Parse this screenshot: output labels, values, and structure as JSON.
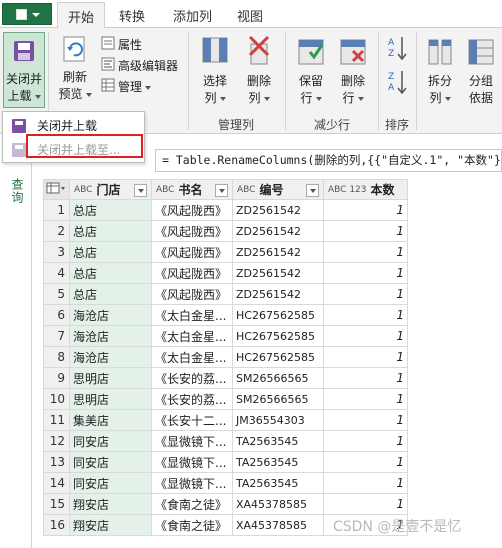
{
  "tabs": {
    "file_label": "",
    "items": [
      {
        "label": "开始",
        "active": true
      },
      {
        "label": "转换"
      },
      {
        "label": "添加列"
      },
      {
        "label": "视图"
      }
    ]
  },
  "ribbon": {
    "close_load": {
      "line1": "关闭并",
      "line2": "上载"
    },
    "refresh": {
      "line1": "刷新",
      "line2": "预览"
    },
    "properties_label": "属性",
    "advanced_editor_label": "高级编辑器",
    "manage_label": "管理",
    "choose_columns": {
      "line1": "选择",
      "line2": "列"
    },
    "remove_columns": {
      "line1": "删除",
      "line2": "列"
    },
    "group_manage_columns": "管理列",
    "keep_rows": {
      "line1": "保留",
      "line2": "行"
    },
    "remove_rows": {
      "line1": "删除",
      "line2": "行"
    },
    "group_reduce_rows": "减少行",
    "group_sort": "排序",
    "split_column": {
      "line1": "拆分",
      "line2": "列"
    },
    "group_by": {
      "line1": "分组",
      "line2": "依据"
    }
  },
  "menu": {
    "item1": "关闭并上载",
    "item2": "关闭并上载至..."
  },
  "queries_pane_label": "查询",
  "formula": "= Table.RenameColumns(删除的列,{{\"自定义.1\", \"本数\"}})",
  "table": {
    "columns": [
      {
        "type": "ABC",
        "name": "门店"
      },
      {
        "type": "ABC",
        "name": "书名"
      },
      {
        "type": "ABC",
        "name": "编号"
      },
      {
        "type": "ABC 123",
        "name": "本数"
      }
    ],
    "rows": [
      {
        "n": "1",
        "store": "总店",
        "book": "《风起陇西》",
        "code": "ZD2561542",
        "count": "1"
      },
      {
        "n": "2",
        "store": "总店",
        "book": "《风起陇西》",
        "code": "ZD2561542",
        "count": "1"
      },
      {
        "n": "3",
        "store": "总店",
        "book": "《风起陇西》",
        "code": "ZD2561542",
        "count": "1"
      },
      {
        "n": "4",
        "store": "总店",
        "book": "《风起陇西》",
        "code": "ZD2561542",
        "count": "1"
      },
      {
        "n": "5",
        "store": "总店",
        "book": "《风起陇西》",
        "code": "ZD2561542",
        "count": "1"
      },
      {
        "n": "6",
        "store": "海沧店",
        "book": "《太白金星...",
        "code": "HC267562585",
        "count": "1"
      },
      {
        "n": "7",
        "store": "海沧店",
        "book": "《太白金星...",
        "code": "HC267562585",
        "count": "1"
      },
      {
        "n": "8",
        "store": "海沧店",
        "book": "《太白金星...",
        "code": "HC267562585",
        "count": "1"
      },
      {
        "n": "9",
        "store": "思明店",
        "book": "《长安的荔...",
        "code": "SM26566565",
        "count": "1"
      },
      {
        "n": "10",
        "store": "思明店",
        "book": "《长安的荔...",
        "code": "SM26566565",
        "count": "1"
      },
      {
        "n": "11",
        "store": "集美店",
        "book": "《长安十二...",
        "code": "JM36554303",
        "count": "1"
      },
      {
        "n": "12",
        "store": "同安店",
        "book": "《显微镜下...",
        "code": "TA2563545",
        "count": "1"
      },
      {
        "n": "13",
        "store": "同安店",
        "book": "《显微镜下...",
        "code": "TA2563545",
        "count": "1"
      },
      {
        "n": "14",
        "store": "同安店",
        "book": "《显微镜下...",
        "code": "TA2563545",
        "count": "1"
      },
      {
        "n": "15",
        "store": "翔安店",
        "book": "《食南之徒》",
        "code": "XA45378585",
        "count": "1"
      },
      {
        "n": "16",
        "store": "翔安店",
        "book": "《食南之徒》",
        "code": "XA45378585",
        "count": "1"
      }
    ]
  },
  "watermark": "CSDN @是壹不是忆"
}
